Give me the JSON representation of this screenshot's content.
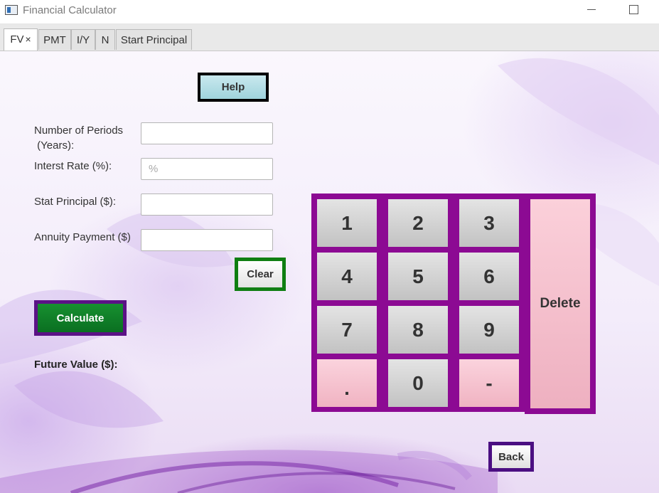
{
  "window": {
    "title": "Financial Calculator"
  },
  "tabs": [
    {
      "label": "FV",
      "close": "×",
      "active": true
    },
    {
      "label": "PMT"
    },
    {
      "label": "I/Y"
    },
    {
      "label": "N"
    },
    {
      "label": "Start Principal"
    }
  ],
  "form": {
    "help_label": "Help",
    "periods_label_line1": "Number of Periods",
    "periods_label_line2": " (Years):",
    "periods_value": "",
    "rate_label": "Interst Rate (%):",
    "rate_value": "",
    "rate_placeholder": "%",
    "principal_label": "Stat Principal ($):",
    "principal_value": "",
    "annuity_label": "Annuity Payment ($)",
    "annuity_value": "",
    "clear_label": "Clear",
    "calculate_label": "Calculate",
    "result_label": "Future Value ($):"
  },
  "keypad": {
    "keys": [
      "1",
      "2",
      "3",
      "4",
      "5",
      "6",
      "7",
      "8",
      "9",
      ".",
      "0",
      "-"
    ],
    "delete_label": "Delete"
  },
  "back_label": "Back",
  "colors": {
    "keypad_border": "#8c0a93",
    "calculate_bg": "#0a6f21",
    "clear_border": "#0f7e12",
    "help_bg": "#9fd3dc",
    "pink_key": "#f0b3c2"
  }
}
